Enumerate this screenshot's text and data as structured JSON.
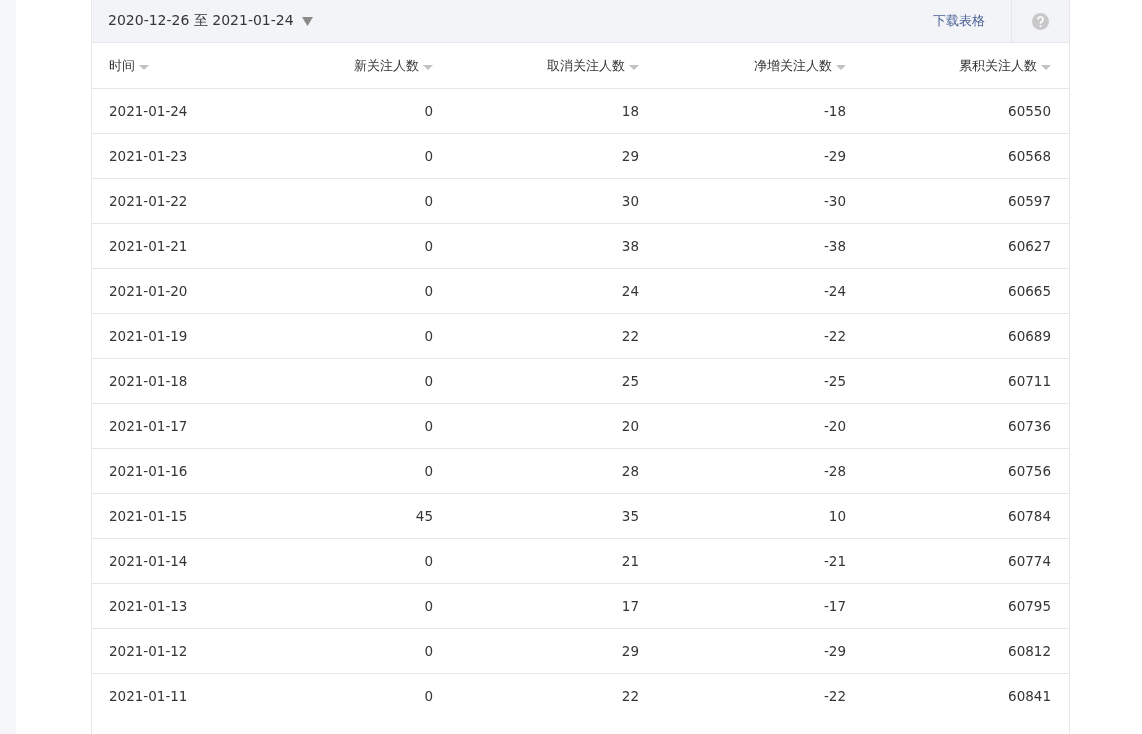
{
  "toolbar": {
    "date_range": "2020-12-26 至 2021-01-24",
    "download_link": "下载表格"
  },
  "table": {
    "columns": [
      "时间",
      "新关注人数",
      "取消关注人数",
      "净增关注人数",
      "累积关注人数"
    ],
    "rows": [
      [
        "2021-01-24",
        "0",
        "18",
        "-18",
        "60550"
      ],
      [
        "2021-01-23",
        "0",
        "29",
        "-29",
        "60568"
      ],
      [
        "2021-01-22",
        "0",
        "30",
        "-30",
        "60597"
      ],
      [
        "2021-01-21",
        "0",
        "38",
        "-38",
        "60627"
      ],
      [
        "2021-01-20",
        "0",
        "24",
        "-24",
        "60665"
      ],
      [
        "2021-01-19",
        "0",
        "22",
        "-22",
        "60689"
      ],
      [
        "2021-01-18",
        "0",
        "25",
        "-25",
        "60711"
      ],
      [
        "2021-01-17",
        "0",
        "20",
        "-20",
        "60736"
      ],
      [
        "2021-01-16",
        "0",
        "28",
        "-28",
        "60756"
      ],
      [
        "2021-01-15",
        "45",
        "35",
        "10",
        "60784"
      ],
      [
        "2021-01-14",
        "0",
        "21",
        "-21",
        "60774"
      ],
      [
        "2021-01-13",
        "0",
        "17",
        "-17",
        "60795"
      ],
      [
        "2021-01-12",
        "0",
        "29",
        "-29",
        "60812"
      ],
      [
        "2021-01-11",
        "0",
        "22",
        "-22",
        "60841"
      ]
    ]
  }
}
